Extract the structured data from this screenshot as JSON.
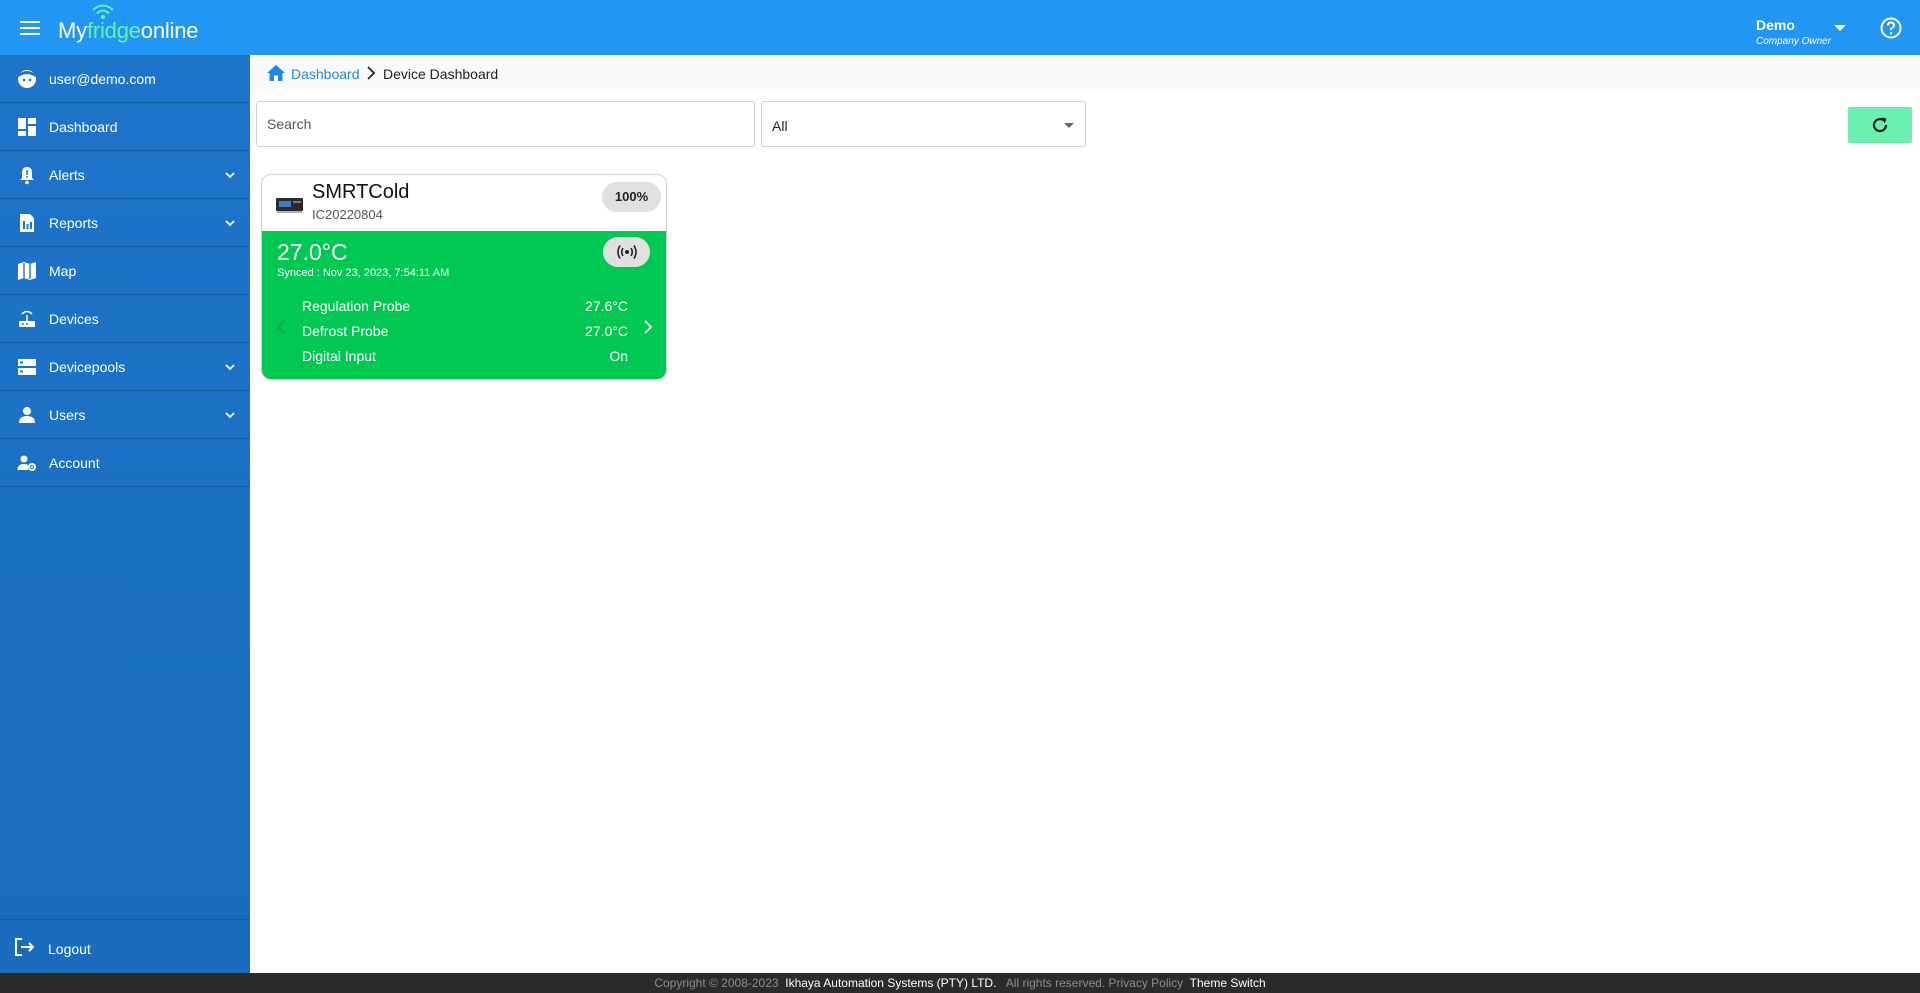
{
  "app": {
    "logo_prefix": "My",
    "logo_highlight": "fridge",
    "logo_suffix": "online"
  },
  "header": {
    "user_name": "Demo",
    "user_role": "Company Owner"
  },
  "sidebar": {
    "account_email": "user@demo.com",
    "items": [
      {
        "label": "Dashboard"
      },
      {
        "label": "Alerts"
      },
      {
        "label": "Reports"
      },
      {
        "label": "Map"
      },
      {
        "label": "Devices"
      },
      {
        "label": "Devicepools"
      },
      {
        "label": "Users"
      },
      {
        "label": "Account"
      }
    ],
    "logout_label": "Logout"
  },
  "breadcrumb": {
    "link": "Dashboard",
    "current": "Device Dashboard"
  },
  "filters": {
    "search_placeholder": "Search",
    "select_value": "All"
  },
  "device": {
    "name": "SMRTCold",
    "id": "IC20220804",
    "battery": "100%",
    "temperature": "27.0°C",
    "synced": "Synced : Nov 23, 2023, 7:54:11 AM",
    "readings": [
      {
        "label": "Regulation Probe",
        "value": "27.6°C"
      },
      {
        "label": "Defrost Probe",
        "value": "27.0°C"
      },
      {
        "label": "Digital Input",
        "value": "On"
      }
    ],
    "status_color": "#00c853"
  },
  "footer": {
    "copyright": "Copyright © 2008-2023",
    "company": "Ikhaya Automation Systems (PTY) LTD.",
    "rights": "All rights reserved.",
    "privacy": "Privacy Policy",
    "theme": "Theme Switch"
  },
  "colors": {
    "primary": "#2196f3",
    "sidebar": "#1e74c9",
    "accent_green": "#69f0ae",
    "link": "#1e88e5"
  }
}
